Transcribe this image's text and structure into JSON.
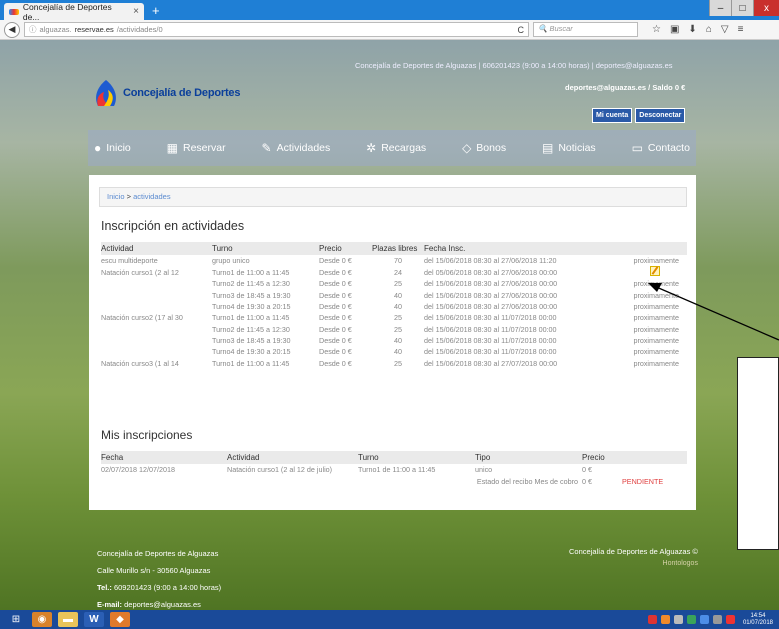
{
  "browser": {
    "tab_title": "Concejalía de Deportes de...",
    "tab_close": "×",
    "new_tab": "+",
    "url_prefix": "alguazas.",
    "url_host": "reservae.es",
    "url_path": "/actividades/0",
    "search_placeholder": "Buscar",
    "window_controls": [
      "–",
      "□",
      "x"
    ]
  },
  "header": {
    "site_name": "Concejalía de Deportes",
    "contact_info": "Concejalía de Deportes de Alguazas | 606201423 (9:00 a 14:00 horas) | deportes@alguazas.es",
    "user_balance": "deportes@alguazas.es / Saldo 0 €",
    "my_account": "Mi cuenta",
    "logout": "Desconectar"
  },
  "menu": [
    {
      "label": "Inicio",
      "icon": "location-pin-icon",
      "glyph": "●"
    },
    {
      "label": "Reservar",
      "icon": "calendar-icon",
      "glyph": "▦"
    },
    {
      "label": "Actividades",
      "icon": "edit-icon",
      "glyph": "✎"
    },
    {
      "label": "Recargas",
      "icon": "gear-icon",
      "glyph": "✲"
    },
    {
      "label": "Bonos",
      "icon": "tag-icon",
      "glyph": "◇"
    },
    {
      "label": "Noticias",
      "icon": "document-icon",
      "glyph": "▤"
    },
    {
      "label": "Contacto",
      "icon": "chat-icon",
      "glyph": "▭"
    }
  ],
  "breadcrumb": {
    "home": "Inicio",
    "sep": " > ",
    "current": "actividades"
  },
  "activities": {
    "title": "Inscripción en actividades",
    "headers": [
      "Actividad",
      "Turno",
      "Precio",
      "Plazas libres",
      "Fecha Insc.",
      ""
    ],
    "rows": [
      {
        "actividad": "escu multideporte",
        "turno": "grupo unico",
        "precio": "Desde 0 €",
        "plazas": "70",
        "fecha": "del 15/06/2018 08:30 al 27/06/2018 11:20",
        "estado": "proximamente"
      },
      {
        "actividad": "Natación curso1 (2 al 12",
        "turno": "Turno1 de 11:00 a 11:45",
        "precio": "Desde 0 €",
        "plazas": "24",
        "fecha": "del 05/06/2018 08:30 al 27/06/2018 00:00",
        "estado": ""
      },
      {
        "actividad": "",
        "turno": "Turno2 de 11:45 a 12:30",
        "precio": "Desde 0 €",
        "plazas": "25",
        "fecha": "del 15/06/2018 08:30 al 27/06/2018 00:00",
        "estado": "proximamente"
      },
      {
        "actividad": "",
        "turno": "Turno3 de 18:45 a 19:30",
        "precio": "Desde 0 €",
        "plazas": "40",
        "fecha": "del 15/06/2018 08:30 al 27/06/2018 00:00",
        "estado": "proximamente"
      },
      {
        "actividad": "",
        "turno": "Turno4 de 19:30 a 20:15",
        "precio": "Desde 0 €",
        "plazas": "40",
        "fecha": "del 15/06/2018 08:30 al 27/06/2018 00:00",
        "estado": "proximamente"
      },
      {
        "actividad": "Natación curso2 (17 al 30",
        "turno": "Turno1 de 11:00 a 11:45",
        "precio": "Desde 0 €",
        "plazas": "25",
        "fecha": "del 15/06/2018 08:30 al 11/07/2018 00:00",
        "estado": "proximamente"
      },
      {
        "actividad": "",
        "turno": "Turno2 de 11:45 a 12:30",
        "precio": "Desde 0 €",
        "plazas": "25",
        "fecha": "del 15/06/2018 08:30 al 11/07/2018 00:00",
        "estado": "proximamente"
      },
      {
        "actividad": "",
        "turno": "Turno3 de 18:45 a 19:30",
        "precio": "Desde 0 €",
        "plazas": "40",
        "fecha": "del 15/06/2018 08:30 al 11/07/2018 00:00",
        "estado": "proximamente"
      },
      {
        "actividad": "",
        "turno": "Turno4 de 19:30 a 20:15",
        "precio": "Desde 0 €",
        "plazas": "40",
        "fecha": "del 15/06/2018 08:30 al 11/07/2018 00:00",
        "estado": "proximamente"
      },
      {
        "actividad": "Natación curso3 (1 al 14",
        "turno": "Turno1 de 11:00 a 11:45",
        "precio": "Desde 0 €",
        "plazas": "25",
        "fecha": "del 15/06/2018 08:30 al 27/07/2018 00:00",
        "estado": "proximamente"
      }
    ]
  },
  "inscriptions": {
    "title": "Mis inscripciones",
    "headers": [
      "Fecha",
      "Actividad",
      "Turno",
      "Tipo",
      "Precio",
      ""
    ],
    "row": {
      "fecha": "02/07/2018 12/07/2018",
      "actividad": "Natación curso1 (2 al 12 de julio)",
      "turno": "Turno1 de 11:00 a 11:45",
      "tipo": "unico",
      "precio": "0 €"
    },
    "receipt_label": "Estado del recibo",
    "month_label": "Mes de cobro",
    "receipt_amount": "0 €",
    "status": "PENDIENTE"
  },
  "footer": {
    "org": "Concejalía de Deportes de Alguazas",
    "address": "Calle Murillo s/n - 30560 Alguazas",
    "tel_label": "Tel.:",
    "tel": " 609201423 (9:00 a 14:00 horas)",
    "email_label": "E-mail:",
    "email": " deportes@alguazas.es",
    "right_org": "Concejalía de Deportes de Alguazas ©",
    "right_sub": "Hontologos"
  },
  "taskbar": {
    "clock_time": "14:54",
    "clock_date": "01/07/2018"
  }
}
